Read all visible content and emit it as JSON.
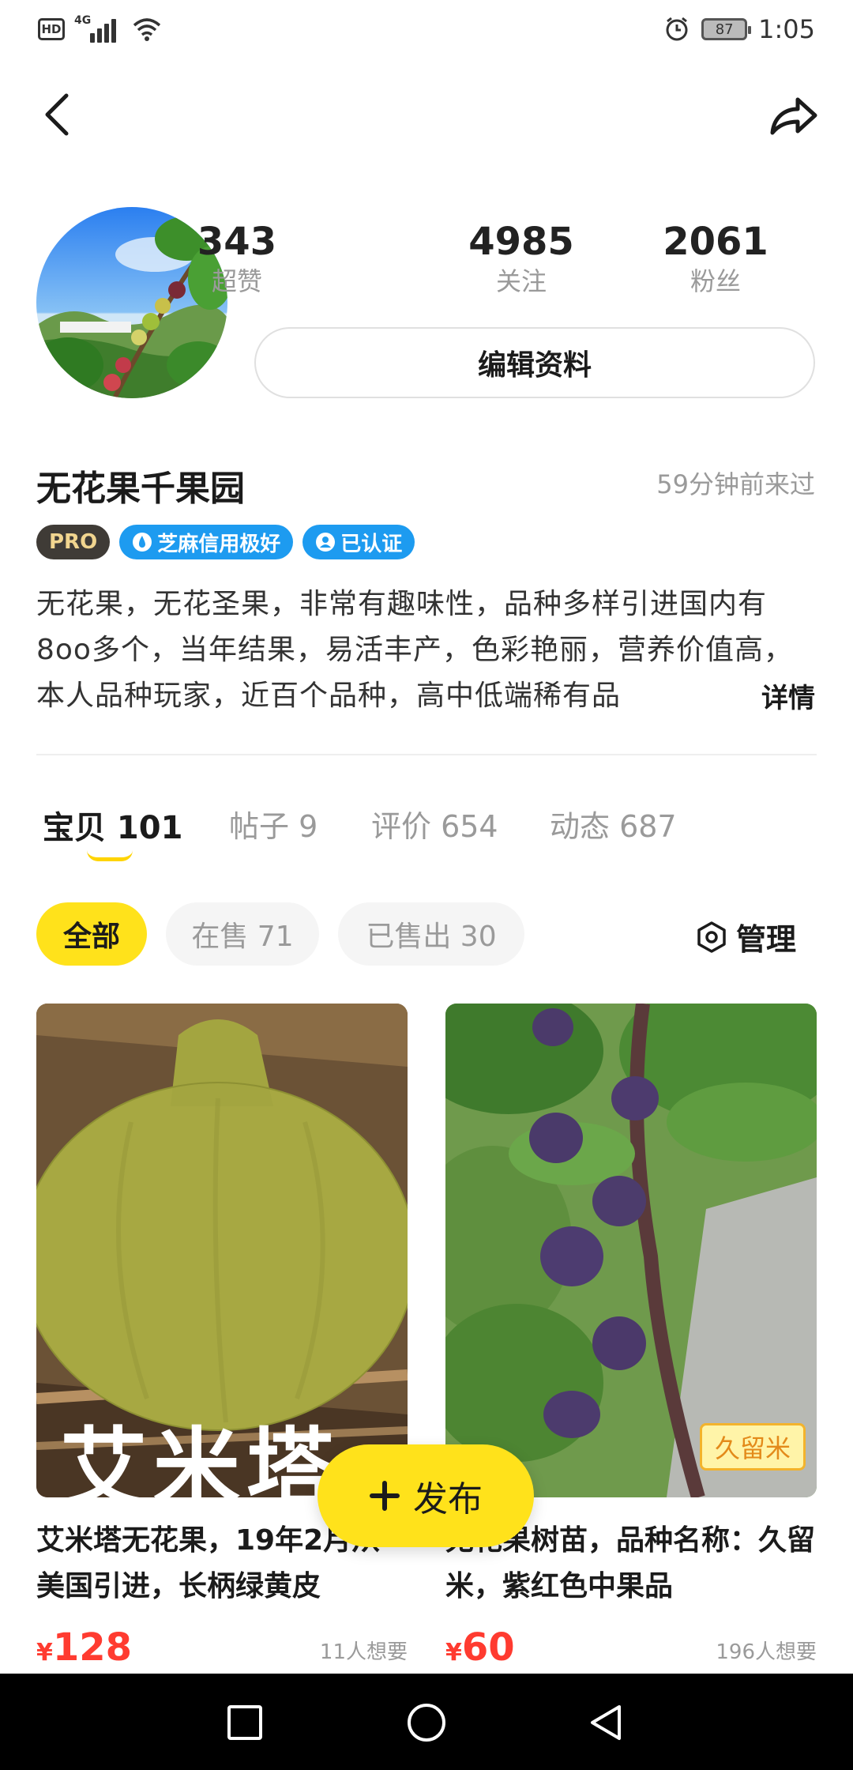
{
  "status_bar": {
    "hd": "HD",
    "network": "4G",
    "battery": "87",
    "time": "1:05"
  },
  "profile": {
    "stats": [
      {
        "value": "343",
        "label": "超赞"
      },
      {
        "value": "4985",
        "label": "关注"
      },
      {
        "value": "2061",
        "label": "粉丝"
      }
    ],
    "edit_label": "编辑资料",
    "name": "无花果千果园",
    "last_seen": "59分钟前来过",
    "badges": {
      "pro": "PRO",
      "credit": "芝麻信用极好",
      "verified": "已认证"
    },
    "description": "无花果，无花圣果，非常有趣味性，品种多样引进国内有8oo多个，当年结果，易活丰产，色彩艳丽，营养价值高，本人品种玩家，近百个品种，高中低端稀有品",
    "detail_label": "详情"
  },
  "tabs": [
    {
      "label": "宝贝 101"
    },
    {
      "label": "帖子 9"
    },
    {
      "label": "评价 654"
    },
    {
      "label": "动态 687"
    }
  ],
  "filters": [
    {
      "label": "全部"
    },
    {
      "label": "在售 71"
    },
    {
      "label": "已售出 30"
    }
  ],
  "manage_label": "管理",
  "products": [
    {
      "title": "艾米塔无花果，19年2月从美国引进，长柄绿黄皮",
      "currency": "¥",
      "price": "128",
      "wants": "11人想要",
      "image_text": "艾米塔"
    },
    {
      "title": "无花果树苗，品种名称：久留米，紫红色中果品",
      "currency": "¥",
      "price": "60",
      "wants": "196人想要",
      "image_tag": "久留米"
    }
  ],
  "fab_label": "发布",
  "colors": {
    "accent": "#ffe21b",
    "price": "#ff3b30",
    "muted": "#9a9a9a",
    "badge_blue": "#1d9bf0"
  }
}
